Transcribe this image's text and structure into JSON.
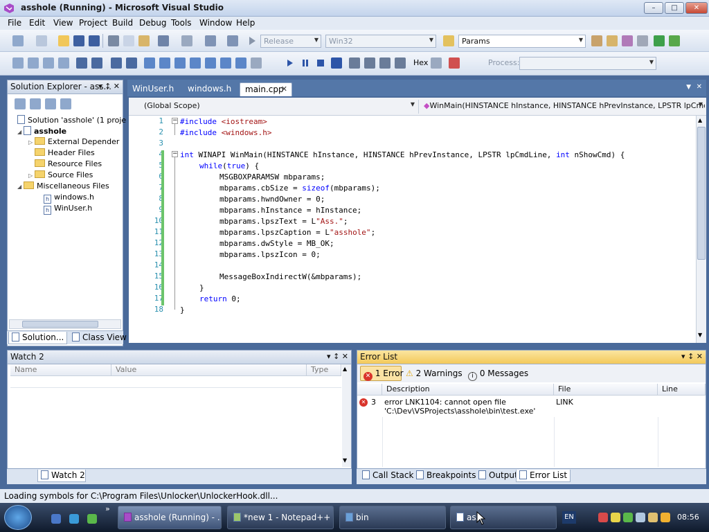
{
  "window": {
    "title": "asshole (Running) - Microsoft Visual Studio",
    "min_label": "–",
    "max_label": "□",
    "close_label": "✕"
  },
  "menu": [
    "File",
    "Edit",
    "View",
    "Project",
    "Build",
    "Debug",
    "Tools",
    "Window",
    "Help"
  ],
  "toolbar": {
    "config": "Release",
    "platform": "Win32",
    "find_text": "Params",
    "hex_label": "Hex",
    "process_label": "Process:"
  },
  "solution_explorer": {
    "header": "Solution Explorer - ass...",
    "header_controls": "▾ ↕ ✕",
    "items": [
      {
        "label": "Solution 'asshole' (1 proje"
      },
      {
        "label": "asshole"
      },
      {
        "label": "External Depender"
      },
      {
        "label": "Header Files"
      },
      {
        "label": "Resource Files"
      },
      {
        "label": "Source Files"
      },
      {
        "label": "Miscellaneous Files"
      },
      {
        "label": "windows.h"
      },
      {
        "label": "WinUser.h"
      }
    ],
    "tabs": [
      "Solution...",
      "Class View"
    ]
  },
  "editor": {
    "tabs": [
      "WinUser.h",
      "windows.h",
      "main.cpp"
    ],
    "close_label": "✕",
    "scope_left": "(Global Scope)",
    "scope_right": "WinMain(HINSTANCE hInstance, HINSTANCE hPrevInstance, LPSTR lpCmdLin",
    "line_numbers": [
      "1",
      "2",
      "3",
      "4",
      "5",
      "6",
      "7",
      "8",
      "9",
      "10",
      "11",
      "12",
      "13",
      "14",
      "15",
      "16",
      "17",
      "18"
    ],
    "code": {
      "l1_kw": "#include",
      "l1_str": " <iostream>",
      "l2_kw": "#include",
      "l2_str": " <windows.h>",
      "l4_kw1": "int",
      "l4_a": " WINAPI WinMain(HINSTANCE hInstance, HINSTANCE hPrevInstance, LPSTR lpCmdLine, ",
      "l4_kw2": "int",
      "l4_b": " nShowCmd) {",
      "l5_kw1": "while",
      "l5_a": "(",
      "l5_kw2": "true",
      "l5_b": ") {",
      "l6": "MSGBOXPARAMSW mbparams;",
      "l7_a": "mbparams.cbSize = ",
      "l7_kw": "sizeof",
      "l7_b": "(mbparams);",
      "l8": "mbparams.hwndOwner = 0;",
      "l9": "mbparams.hInstance = hInstance;",
      "l10_a": "mbparams.lpszText = L",
      "l10_str": "\"Ass.\"",
      "l10_b": ";",
      "l11_a": "mbparams.lpszCaption = L",
      "l11_str": "\"asshole\"",
      "l11_b": ";",
      "l12": "mbparams.dwStyle = MB_OK;",
      "l13": "mbparams.lpszIcon = 0;",
      "l15": "MessageBoxIndirectW(&mbparams);",
      "l16": "}",
      "l17_kw": "return",
      "l17_a": " 0;",
      "l18": "}"
    }
  },
  "watch": {
    "header": "Watch 2",
    "header_controls": "▾ ↕ ✕",
    "columns": [
      "Name",
      "Value",
      "Type"
    ],
    "tab": "Watch 2"
  },
  "error_list": {
    "header": "Error List",
    "header_controls": "▾ ↕ ✕",
    "filter_errors": "1 Error",
    "filter_warnings": "2 Warnings",
    "filter_messages": "0 Messages",
    "columns": [
      "Description",
      "File",
      "Line"
    ],
    "rows": [
      {
        "index": "3",
        "description_line1": "error LNK1104: cannot open file",
        "description_line2": "'C:\\Dev\\VSProjects\\asshole\\bin\\test.exe'",
        "file": "LINK",
        "line": ""
      }
    ],
    "tabs": [
      "Call Stack",
      "Breakpoints",
      "Output",
      "Error List"
    ]
  },
  "status": {
    "text": "Loading symbols for C:\\Program Files\\Unlocker\\UnlockerHook.dll..."
  },
  "taskbar": {
    "buttons": [
      "asshole (Running) - ...",
      "*new  1 - Notepad++",
      "bin",
      "ass"
    ],
    "lang": "EN",
    "clock": "08:56"
  },
  "colors": {
    "keyword": "#0000ff",
    "string": "#a31515",
    "line_number": "#2b91af",
    "change_bar": "#6cc46c",
    "error_icon": "#d9342b",
    "warning_icon": "#f2c12e"
  }
}
